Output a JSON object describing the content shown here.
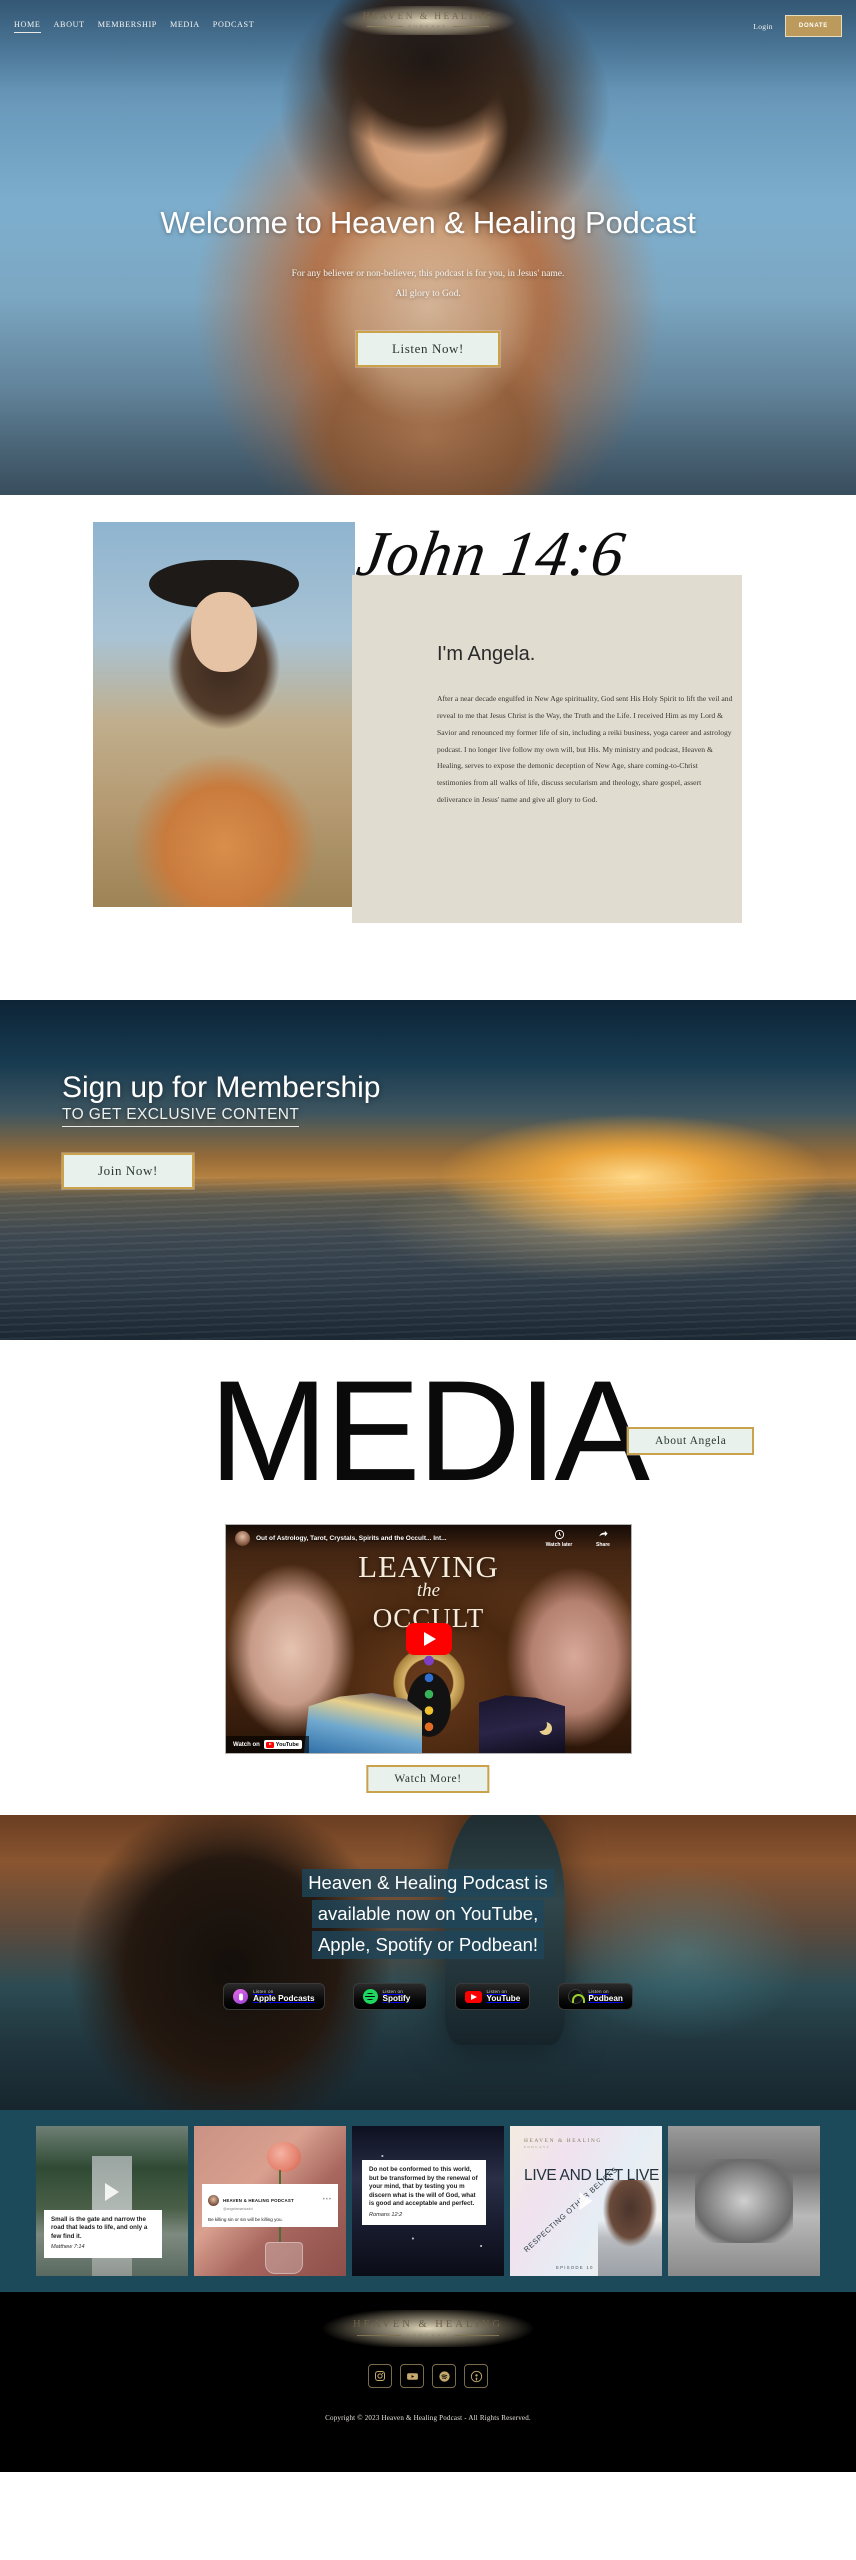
{
  "brand": {
    "name": "HEAVEN & HEALING",
    "sub": "PODCAST"
  },
  "nav": {
    "items": [
      {
        "label": "HOME",
        "active": true
      },
      {
        "label": "ABOUT",
        "active": false
      },
      {
        "label": "MEMBERSHIP",
        "active": false
      },
      {
        "label": "MEDIA",
        "active": false
      },
      {
        "label": "PODCAST",
        "active": false
      }
    ],
    "login_label": "Login",
    "donate_label": "DONATE"
  },
  "hero": {
    "title": "Welcome to Heaven & Healing Podcast",
    "sub_line1": "For any believer or non-believer, this podcast is for you, in Jesus' name.",
    "sub_line2": "All glory to God.",
    "cta": "Listen Now!"
  },
  "about": {
    "verse": "John 14:6",
    "heading": "I'm Angela.",
    "body": "After a near decade engulfed in New Age spirituality, God sent His Holy Spirit to lift the veil and reveal to me that Jesus Christ is the Way, the Truth and the Life. I received Him as my Lord & Savior and renounced my former life of sin, including a reiki business, yoga career and astrology podcast. I no longer live follow my own will, but His. My ministry and podcast, Heaven & Healing, serves to expose the demonic deception of New Age, share coming-to-Christ testimonies from all walks of life, discuss secularism and theology, share gospel, assert deliverance in Jesus' name and give all glory to God.",
    "cta": "About Angela"
  },
  "membership": {
    "title": "Sign up for Membership",
    "subtitle": "TO GET EXCLUSIVE CONTENT",
    "cta": "Join Now!"
  },
  "media": {
    "word": "MEDIA",
    "video": {
      "title": "Out of Astrology, Tarot, Crystals, Spirits and the Occult... Int...",
      "watch_later": "Watch later",
      "share": "Share",
      "watch_on": "Watch on",
      "provider": "YouTube",
      "thumb_line1": "LEAVING",
      "thumb_line2": "the",
      "thumb_line3": "OCCULT"
    },
    "cta": "Watch More!"
  },
  "platforms": {
    "line1": "Heaven & Healing Podcast is",
    "line2": "available now on YouTube,",
    "line3": "Apple, Spotify or Podbean!",
    "badges": [
      {
        "small": "Listen on",
        "big": "Apple Podcasts",
        "icon": "apple-podcasts-icon"
      },
      {
        "small": "Listen on",
        "big": "Spotify",
        "icon": "spotify-icon"
      },
      {
        "small": "Listen on",
        "big": "YouTube",
        "icon": "youtube-icon"
      },
      {
        "small": "Listen on",
        "big": "Podbean",
        "icon": "podbean-icon"
      }
    ]
  },
  "feed": {
    "posts": [
      {
        "kind": "quote-video",
        "quote": "Small is the gate and narrow the road that leads to life, and only a few find it.",
        "reference": "Matthew 7:14"
      },
      {
        "kind": "instagram-card",
        "account_name": "HEAVEN & HEALING PODCAST",
        "handle": "@angelamarisadci",
        "caption": "Be killing sin or sin will be killing you."
      },
      {
        "kind": "quote",
        "quote": "Do not be conformed to this world, but be transformed by the renewal of your mind, that by testing you m  discern what is the will of God, what is good and acceptable and perfect.",
        "reference": "Romans 12:2"
      },
      {
        "kind": "episode-cover",
        "logo": "HEAVEN & HEALING",
        "logo_sub": "PODCAST",
        "title": "LIVE AND LET LIVE",
        "subtitle": "RESPECTING OTHER BELIEFS",
        "episode": "EPISODE 10"
      },
      {
        "kind": "photo"
      }
    ]
  },
  "footer": {
    "logo": "HEAVEN & HEALING",
    "logo_sub": "PODCAST",
    "socials": [
      {
        "name": "instagram-icon"
      },
      {
        "name": "youtube-icon"
      },
      {
        "name": "spotify-icon"
      },
      {
        "name": "apple-podcasts-icon"
      }
    ],
    "copyright": "Copyright © 2023 Heaven & Healing Podcast - All Rights Reserved."
  }
}
